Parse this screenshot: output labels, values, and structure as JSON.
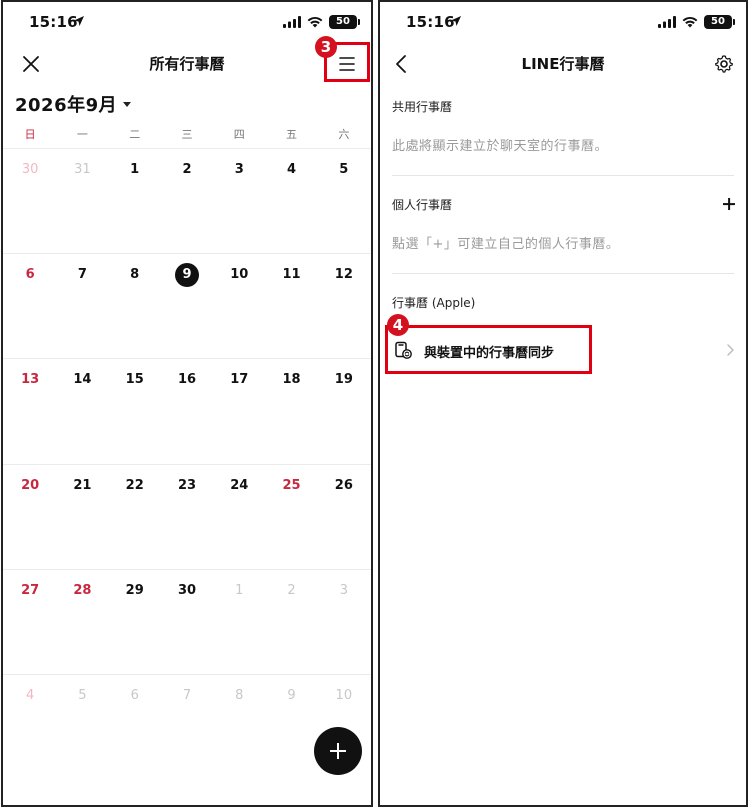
{
  "status": {
    "time": "15:16",
    "battery": "50"
  },
  "left": {
    "title": "所有行事曆",
    "month": "2026年9月",
    "step_badge": "3",
    "weekdays": [
      "日",
      "一",
      "二",
      "三",
      "四",
      "五",
      "六"
    ],
    "weeks": [
      [
        "30",
        "31",
        "1",
        "2",
        "3",
        "4",
        "5"
      ],
      [
        "6",
        "7",
        "8",
        "9",
        "10",
        "11",
        "12"
      ],
      [
        "13",
        "14",
        "15",
        "16",
        "17",
        "18",
        "19"
      ],
      [
        "20",
        "21",
        "22",
        "23",
        "24",
        "25",
        "26"
      ],
      [
        "27",
        "28",
        "29",
        "30",
        "1",
        "2",
        "3"
      ],
      [
        "4",
        "5",
        "6",
        "7",
        "8",
        "9",
        "10"
      ]
    ],
    "today": "9",
    "red_dates": [
      "25",
      "28"
    ]
  },
  "right": {
    "title": "LINE行事曆",
    "shared_label": "共用行事曆",
    "shared_desc": "此處將顯示建立於聊天室的行事曆。",
    "personal_label": "個人行事曆",
    "personal_desc": "點選「+」可建立自己的個人行事曆。",
    "apple_label": "行事曆 (Apple)",
    "sync_label": "與裝置中的行事曆同步",
    "step_badge": "4"
  },
  "colors": {
    "highlight": "#e00012",
    "badge": "#d4121f",
    "sunday": "#c8283f"
  },
  "icons": [
    "close-icon",
    "menu-icon",
    "back-icon",
    "gear-icon",
    "plus-icon",
    "calendar-sync-icon",
    "chevron-right-icon",
    "location-arrow-icon",
    "signal-icon",
    "wifi-icon",
    "battery-icon"
  ]
}
